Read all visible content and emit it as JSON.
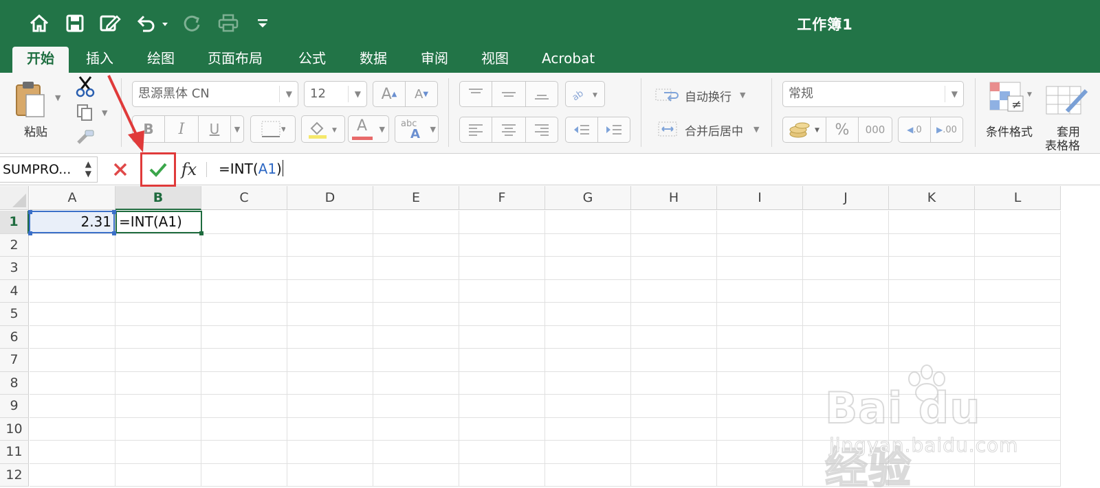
{
  "window": {
    "title": "工作簿1"
  },
  "quick_access": {
    "icons": [
      "home-icon",
      "save-icon",
      "edit-icon",
      "undo-icon",
      "redo-icon",
      "print-icon",
      "customize-icon"
    ]
  },
  "tabs": [
    {
      "label": "开始",
      "active": true
    },
    {
      "label": "插入"
    },
    {
      "label": "绘图"
    },
    {
      "label": "页面布局"
    },
    {
      "label": "公式"
    },
    {
      "label": "数据"
    },
    {
      "label": "审阅"
    },
    {
      "label": "视图"
    },
    {
      "label": "Acrobat"
    }
  ],
  "ribbon": {
    "clipboard": {
      "paste_label": "粘贴"
    },
    "font": {
      "name": "思源黑体 CN",
      "size": "12",
      "bold_label": "B",
      "italic_label": "I",
      "underline_label": "U",
      "font_color_label": "A",
      "increase_label": "A",
      "decrease_label": "A",
      "phonetic_label": "abc"
    },
    "alignment": {
      "wrap_label": "自动换行",
      "merge_label": "合并后居中"
    },
    "number": {
      "format": "常规",
      "percent_label": "%",
      "comma_label": "000",
      "inc_decimal_label": ".0",
      "dec_decimal_label": ".00"
    },
    "styles": {
      "conditional_label": "条件格式",
      "table_label_1": "套用",
      "table_label_2": "表格格"
    }
  },
  "formula_bar": {
    "name_box": "SUMPRO...",
    "formula_prefix": "=INT(",
    "formula_ref": "A1",
    "formula_suffix": ")"
  },
  "sheet": {
    "columns": [
      "A",
      "B",
      "C",
      "D",
      "E",
      "F",
      "G",
      "H",
      "I",
      "J",
      "K",
      "L"
    ],
    "rows": [
      "1",
      "2",
      "3",
      "4",
      "5",
      "6",
      "7",
      "8",
      "9",
      "10",
      "11",
      "12"
    ],
    "selected_column": "B",
    "selected_row": "1",
    "cells": {
      "A1": "2.31",
      "B1": "=INT(A1)"
    }
  },
  "watermark": {
    "logo_text": "Bai du 经验",
    "url": "jingyan.baidu.com"
  },
  "colors": {
    "title_bar": "#227447",
    "accent_green": "#1e6b3e",
    "annotation_red": "#e03a3a",
    "reference_blue": "#2d68c4"
  }
}
